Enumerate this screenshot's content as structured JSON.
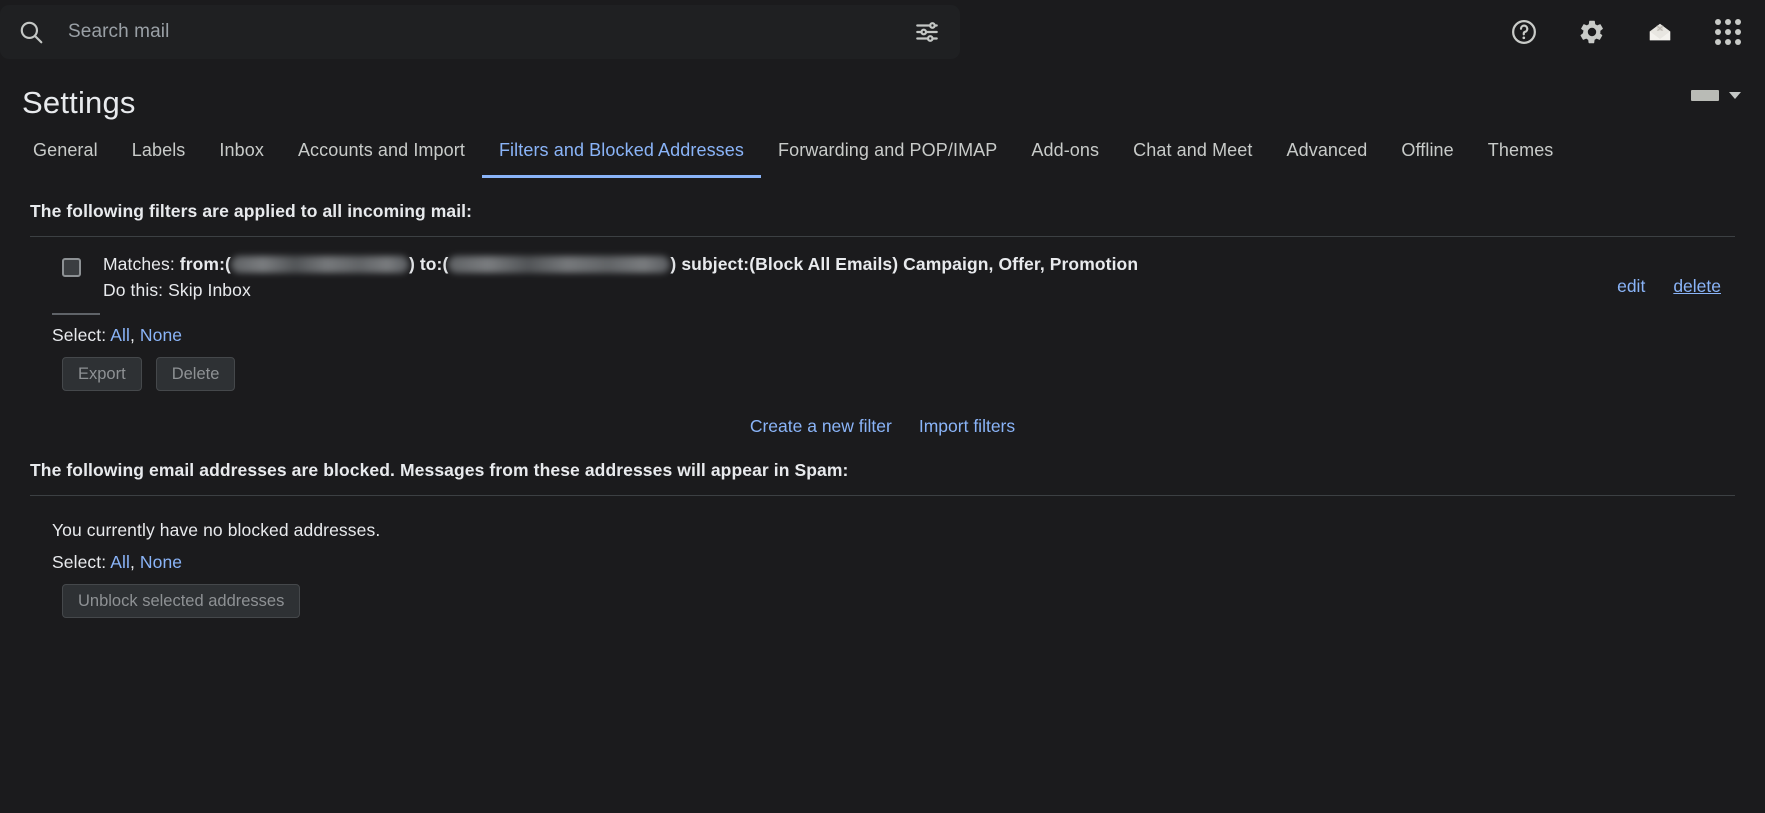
{
  "search": {
    "placeholder": "Search mail",
    "value": "",
    "search_icon": "search-icon",
    "tune_icon": "tune-options-icon"
  },
  "topbar_icons": {
    "help": "help-circle-icon",
    "settings": "gear-icon",
    "avatar": "open-envelope-avatar-icon",
    "apps": "apps-grid-icon"
  },
  "header": {
    "title": "Settings",
    "language_caret": "chevron-down-icon"
  },
  "tabs": [
    {
      "label": "General",
      "active": false
    },
    {
      "label": "Labels",
      "active": false
    },
    {
      "label": "Inbox",
      "active": false
    },
    {
      "label": "Accounts and Import",
      "active": false
    },
    {
      "label": "Filters and Blocked Addresses",
      "active": true
    },
    {
      "label": "Forwarding and POP/IMAP",
      "active": false
    },
    {
      "label": "Add-ons",
      "active": false
    },
    {
      "label": "Chat and Meet",
      "active": false
    },
    {
      "label": "Advanced",
      "active": false
    },
    {
      "label": "Offline",
      "active": false
    },
    {
      "label": "Themes",
      "active": false
    }
  ],
  "filters_section": {
    "heading": "The following filters are applied to all incoming mail:",
    "filter": {
      "matches_prefix": "Matches:",
      "from_label": "from:(",
      "from_value_redacted": "",
      "from_close": ")",
      "to_label": "to:(",
      "to_value_redacted": "",
      "to_close": ")",
      "subject_label": "subject:(Block All Emails) Campaign, Offer, Promotion",
      "do_this": "Do this: Skip Inbox",
      "edit_link": "edit",
      "delete_link": "delete"
    },
    "select_label": "Select:",
    "select_all": "All",
    "select_separator": ",",
    "select_none": "None",
    "export_button": "Export",
    "delete_button": "Delete",
    "create_filter_link": "Create a new filter",
    "import_filters_link": "Import filters"
  },
  "blocked_section": {
    "heading": "The following email addresses are blocked. Messages from these addresses will appear in Spam:",
    "empty_message": "You currently have no blocked addresses.",
    "select_label": "Select:",
    "select_all": "All",
    "select_separator": ",",
    "select_none": "None",
    "unblock_button": "Unblock selected addresses"
  },
  "colors": {
    "background": "#1b1b1d",
    "accent_link": "#8ab4f8",
    "text_primary": "#e8eaed",
    "text_muted": "#9aa0a6",
    "divider": "#3c4043"
  }
}
